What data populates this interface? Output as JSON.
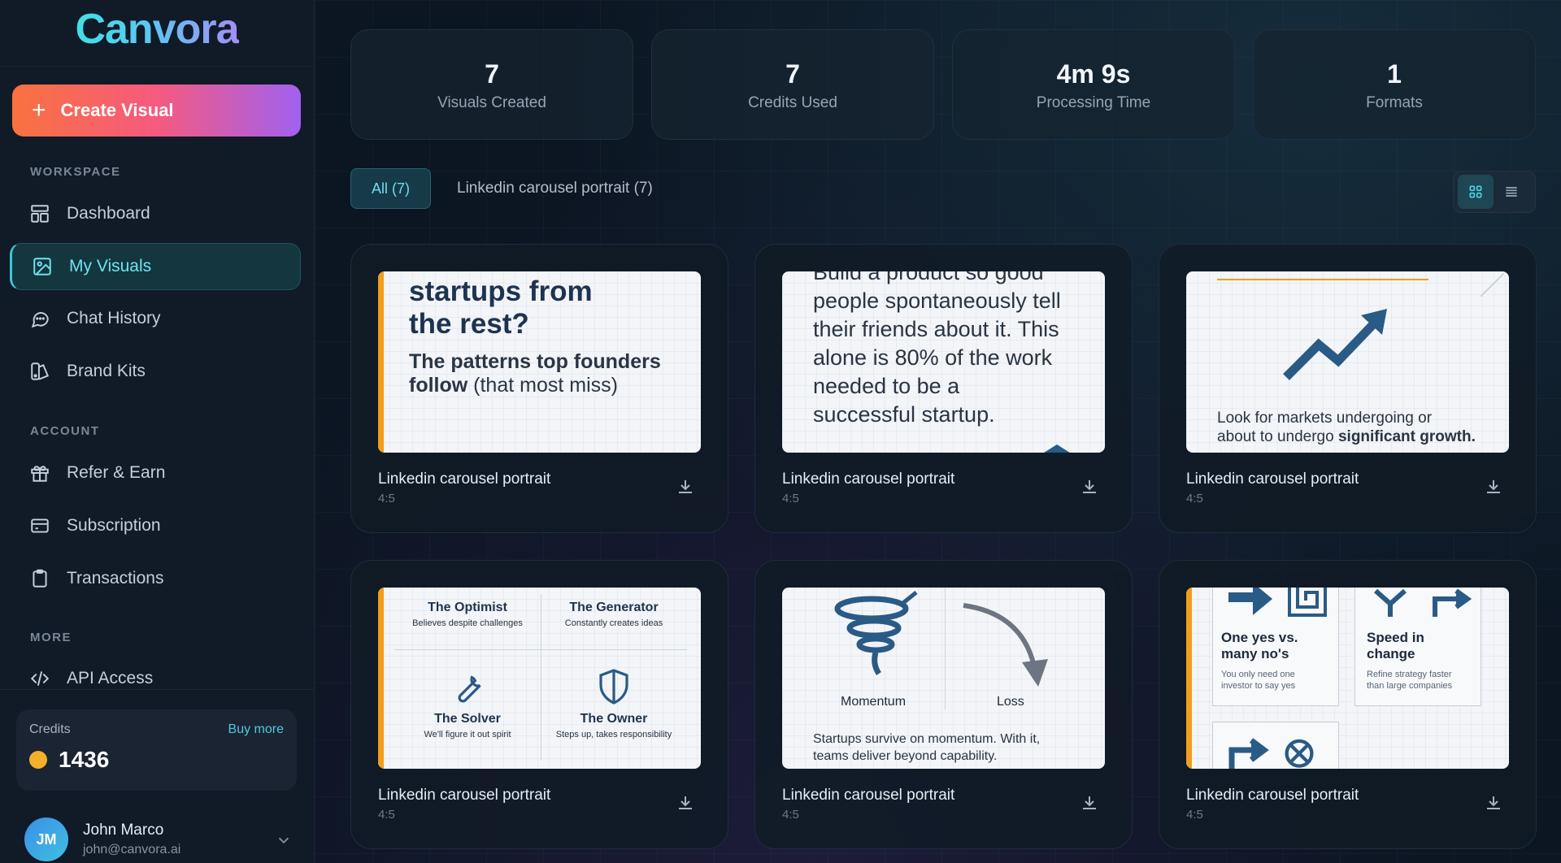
{
  "brand": {
    "name": "Canvora"
  },
  "sidebar": {
    "create_label": "Create Visual",
    "sections": {
      "workspace": "WORKSPACE",
      "account": "ACCOUNT",
      "more": "MORE"
    },
    "items": [
      {
        "label": "Dashboard",
        "icon": "dashboard-icon"
      },
      {
        "label": "My Visuals",
        "icon": "image-icon",
        "active": true
      },
      {
        "label": "Chat History",
        "icon": "chat-icon"
      },
      {
        "label": "Brand Kits",
        "icon": "brand-kit-icon"
      },
      {
        "label": "Refer & Earn",
        "icon": "gift-icon"
      },
      {
        "label": "Subscription",
        "icon": "credit-card-icon"
      },
      {
        "label": "Transactions",
        "icon": "clipboard-icon"
      },
      {
        "label": "API Access",
        "icon": "code-icon"
      }
    ],
    "credits": {
      "label": "Credits",
      "buy_label": "Buy more",
      "value": "1436"
    },
    "user": {
      "initials": "JM",
      "name": "John Marco",
      "email": "john@canvora.ai"
    }
  },
  "stats": [
    {
      "value": "7",
      "label": "Visuals Created"
    },
    {
      "value": "7",
      "label": "Credits Used"
    },
    {
      "value": "4m 9s",
      "label": "Processing Time"
    },
    {
      "value": "1",
      "label": "Formats"
    }
  ],
  "filters": {
    "all": "All (7)",
    "other": "Linkedin carousel portrait (7)"
  },
  "cards": [
    {
      "title": "Linkedin carousel portrait",
      "ratio": "4:5",
      "preview": {
        "line1": "startups from",
        "line2": "the rest?",
        "line3": "The patterns top founders",
        "line4_bold": "follow",
        "line4_rest": " (that most miss)"
      }
    },
    {
      "title": "Linkedin carousel portrait",
      "ratio": "4:5",
      "preview": {
        "line0": "Build a product so good",
        "line1": "people spontaneously tell",
        "line2": "their friends about it. This",
        "line3": "alone is 80% of the work",
        "line4": "needed to be a",
        "line5": "successful startup."
      }
    },
    {
      "title": "Linkedin carousel portrait",
      "ratio": "4:5",
      "preview": {
        "line1": "Look for markets undergoing or",
        "line2_pre": "about to undergo ",
        "line2_bold": "significant growth."
      }
    },
    {
      "title": "Linkedin carousel portrait",
      "ratio": "4:5",
      "preview": {
        "q1_title": "The Optimist",
        "q1_sub": "Believes despite challenges",
        "q2_title": "The Generator",
        "q2_sub": "Constantly creates ideas",
        "q3_title": "The Solver",
        "q3_sub": "We'll figure it out spirit",
        "q4_title": "The Owner",
        "q4_sub": "Steps up, takes responsibility"
      }
    },
    {
      "title": "Linkedin carousel portrait",
      "ratio": "4:5",
      "preview": {
        "left": "Momentum",
        "right": "Loss",
        "body1": "Startups survive on momentum. With it,",
        "body2": "teams deliver beyond capability."
      }
    },
    {
      "title": "Linkedin carousel portrait",
      "ratio": "4:5",
      "preview": {
        "b1_title1": "One yes vs.",
        "b1_title2": "many no's",
        "b1_sub1": "You only need one",
        "b1_sub2": "investor to say yes",
        "b2_title1": "Speed in",
        "b2_title2": "change",
        "b2_sub1": "Refine strategy faster",
        "b2_sub2": "than large companies"
      }
    }
  ],
  "colors": {
    "accent": "#3cc8d8",
    "brand_gradient_start": "#f8723f",
    "brand_gradient_end": "#a061f0",
    "thumb_accent": "#f29d1e",
    "coin": "#f4b02a"
  }
}
